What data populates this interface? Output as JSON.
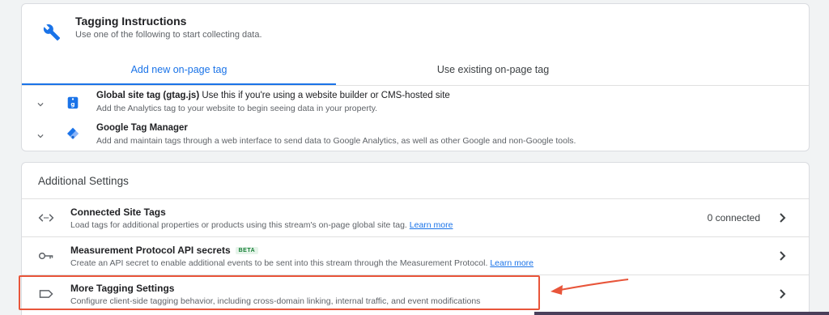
{
  "tagging_instructions": {
    "icon": "wrench-icon",
    "title": "Tagging Instructions",
    "subtitle": "Use one of the following to start collecting data."
  },
  "tabs": [
    {
      "label": "Add new on-page tag",
      "active": true
    },
    {
      "label": "Use existing on-page tag",
      "active": false
    }
  ],
  "options": [
    {
      "icon": "gtag-icon",
      "title_bold": "Global site tag (gtag.js)",
      "title_rest": " Use this if you're using a website builder or CMS-hosted site",
      "description": "Add the Analytics tag to your website to begin seeing data in your property."
    },
    {
      "icon": "tag-manager-icon",
      "title_bold": "Google Tag Manager",
      "title_rest": "",
      "description": "Add and maintain tags through a web interface to send data to Google Analytics, as well as other Google and non-Google tools."
    }
  ],
  "additional_settings": {
    "header": "Additional Settings",
    "rows": [
      {
        "icon": "code-icon",
        "title": "Connected Site Tags",
        "description": "Load tags for additional properties or products using this stream's on-page global site tag.",
        "link": "Learn more",
        "status": "0 connected"
      },
      {
        "icon": "key-icon",
        "title": "Measurement Protocol API secrets",
        "badge": "BETA",
        "description": "Create an API secret to enable additional events to be sent into this stream through the Measurement Protocol.",
        "link": "Learn more"
      },
      {
        "icon": "label-icon",
        "title": "More Tagging Settings",
        "description": "Configure client-side tagging behavior, including cross-domain linking, internal traffic, and event modifications"
      }
    ]
  },
  "colors": {
    "accent": "#1a73e8",
    "annotation": "#e8553a"
  }
}
